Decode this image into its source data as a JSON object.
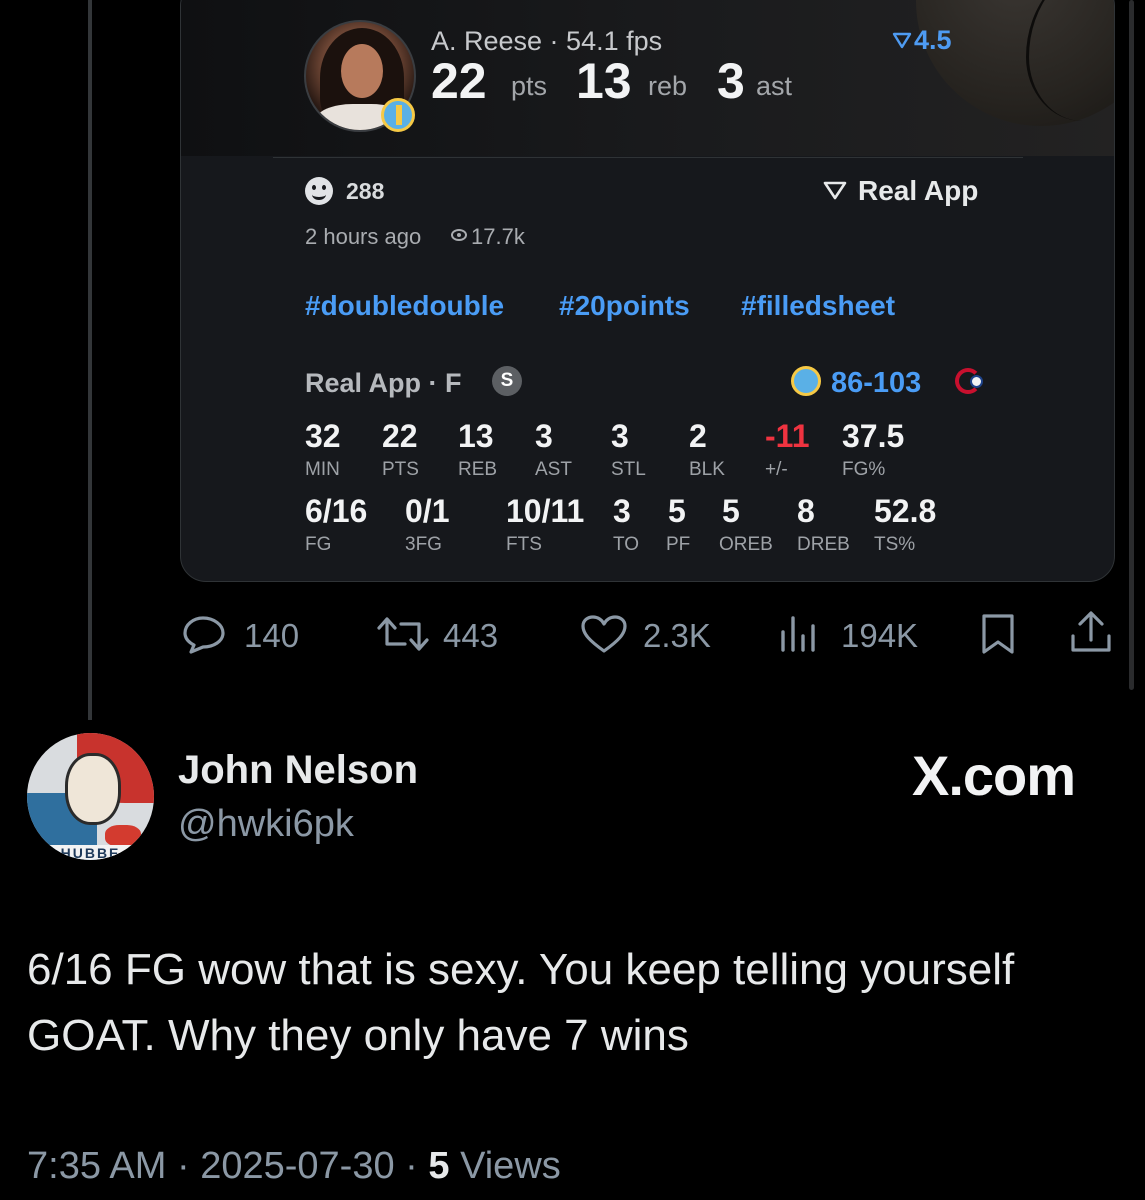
{
  "embedded_card": {
    "player": {
      "name_line": "A. Reese · 54.1 fps",
      "points": "22",
      "points_unit": "pts",
      "rebounds": "13",
      "rebounds_unit": "reb",
      "assists": "3",
      "assists_unit": "ast",
      "line_delta": "4.5"
    },
    "reactions_count": "288",
    "source_link": "Real App",
    "time_ago": "2 hours ago",
    "views": "17.7k",
    "hashtags": [
      "#doubledouble",
      "#20points",
      "#filledsheet"
    ],
    "box_score": {
      "source": "Real App · F",
      "badge": "S",
      "final_score": "86-103",
      "row1": [
        {
          "value": "32",
          "label": "MIN"
        },
        {
          "value": "22",
          "label": "PTS"
        },
        {
          "value": "13",
          "label": "REB"
        },
        {
          "value": "3",
          "label": "AST"
        },
        {
          "value": "3",
          "label": "STL"
        },
        {
          "value": "2",
          "label": "BLK"
        },
        {
          "value": "-11",
          "label": "+/-"
        },
        {
          "value": "37.5",
          "label": "FG%"
        }
      ],
      "row2": [
        {
          "value": "6/16",
          "label": "FG"
        },
        {
          "value": "0/1",
          "label": "3FG"
        },
        {
          "value": "10/11",
          "label": "FTS"
        },
        {
          "value": "3",
          "label": "TO"
        },
        {
          "value": "5",
          "label": "PF"
        },
        {
          "value": "5",
          "label": "OREB"
        },
        {
          "value": "8",
          "label": "DREB"
        },
        {
          "value": "52.8",
          "label": "TS%"
        }
      ]
    }
  },
  "tweet_actions": {
    "replies": "140",
    "reposts": "443",
    "likes": "2.3K",
    "views": "194K"
  },
  "reply": {
    "author_name": "John Nelson",
    "author_handle": "@hwki6pk",
    "avatar_text": "HUBBE",
    "watermark": "X.com",
    "text": "6/16 FG wow that is sexy. You keep telling yourself GOAT. Why they only have 7 wins",
    "time": "7:35 AM",
    "date": "2025-07-30",
    "views_count": "5",
    "views_label": "Views"
  },
  "colors": {
    "background": "#000000",
    "card": "#16181c",
    "link_blue": "#4a9cf5",
    "negative_red": "#ef3340",
    "muted": "#8b98a5"
  },
  "icons": [
    "smile-emoji-icon",
    "real-app-logo-icon",
    "eye-icon",
    "reply-icon",
    "repost-icon",
    "like-icon",
    "views-icon",
    "bookmark-icon",
    "share-icon"
  ]
}
